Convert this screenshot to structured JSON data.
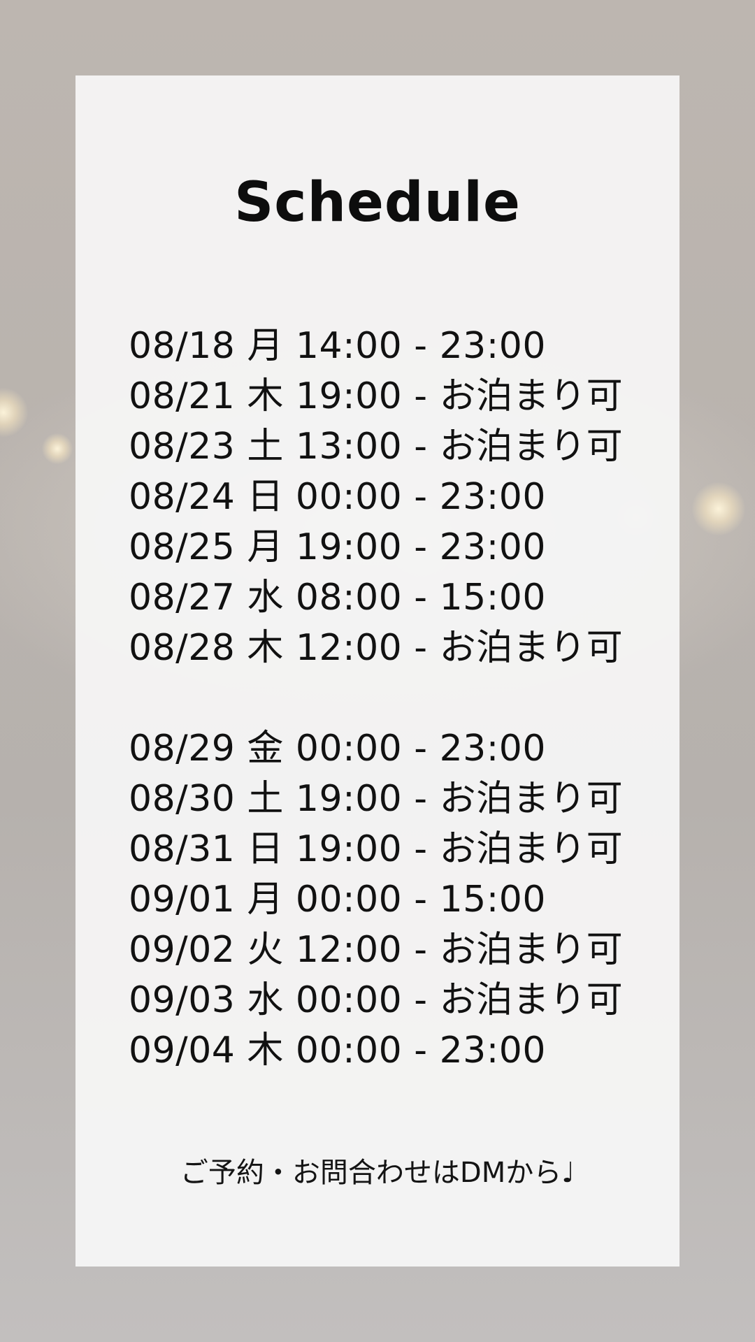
{
  "title": "Schedule",
  "schedule": [
    "08/18 月 14:00 - 23:00",
    "08/21 木 19:00 - お泊まり可",
    "08/23 土 13:00 - お泊まり可",
    "08/24 日 00:00 - 23:00",
    "08/25 月 19:00 - 23:00",
    "08/27 水 08:00 - 15:00",
    "08/28 木 12:00 - お泊まり可",
    "08/29 金 00:00 - 23:00",
    "08/30 土 19:00 - お泊まり可",
    "08/31 日 19:00 - お泊まり可",
    "09/01 月 00:00 - 15:00",
    "09/02 火 12:00 - お泊まり可",
    "09/03 水 00:00 - お泊まり可",
    "09/04 木 00:00 - 23:00"
  ],
  "footer": "ご予約・お問合わせはDMから♩",
  "colors": {
    "card": "#f5f5f6",
    "text": "#111111",
    "background": "#bbb5b0"
  }
}
